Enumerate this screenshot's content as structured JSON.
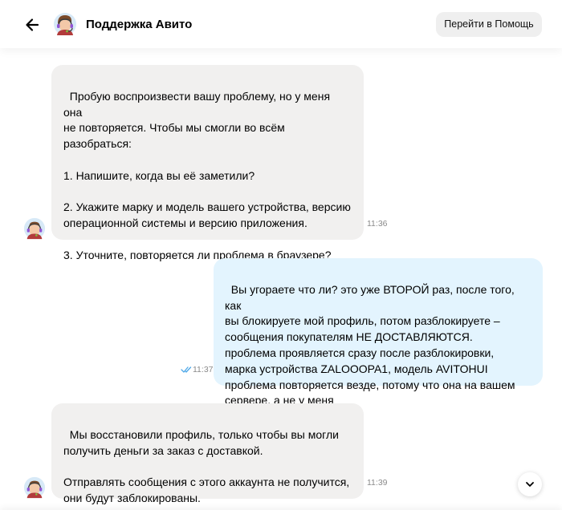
{
  "header": {
    "title": "Поддержка Авито",
    "help_button_label": "Перейти в Помощь"
  },
  "messages": [
    {
      "direction": "incoming",
      "text": "Пробую воспроизвести вашу проблему, но у меня она\nне повторяется. Чтобы мы смогли во всём\nразобраться:\n\n1. Напишите, когда вы её заметили?\n\n2. Укажите марку и модель вашего устройства, версию\nоперационной системы и версию приложения.\n\n3. Уточните, повторяется ли проблема в браузере?",
      "time": "11:36"
    },
    {
      "direction": "outgoing",
      "text": "Вы угораете что ли? это уже ВТОРОЙ раз, после того, как\nвы блокируете мой профиль, потом разблокируете –\nсообщения покупателям НЕ ДОСТАВЛЯЮТСЯ.\nпроблема проявляется сразу после разблокировки,\nмарка устройства ZALOOOPA1, модель AVITOHUI\nпроблема повторяется везде, потому что она на вашем\nсервере, а не у меня",
      "time": "11:37",
      "status": "read"
    },
    {
      "direction": "incoming",
      "text": "Мы восстановили профиль, только чтобы вы могли\nполучить деньги за заказ с доставкой.\n\nОтправлять сообщения с этого аккаунта не получится,\nони будут заблокированы.",
      "time": "11:39"
    }
  ],
  "icons": {
    "back": "arrow-left-icon",
    "avatar": "support-agent-avatar",
    "read_status": "double-check-icon",
    "scroll": "chevron-down-icon"
  },
  "colors": {
    "incoming_bubble": "#f1f0ef",
    "outgoing_bubble": "#e3f4fe",
    "read_check": "#4ea8e8"
  }
}
